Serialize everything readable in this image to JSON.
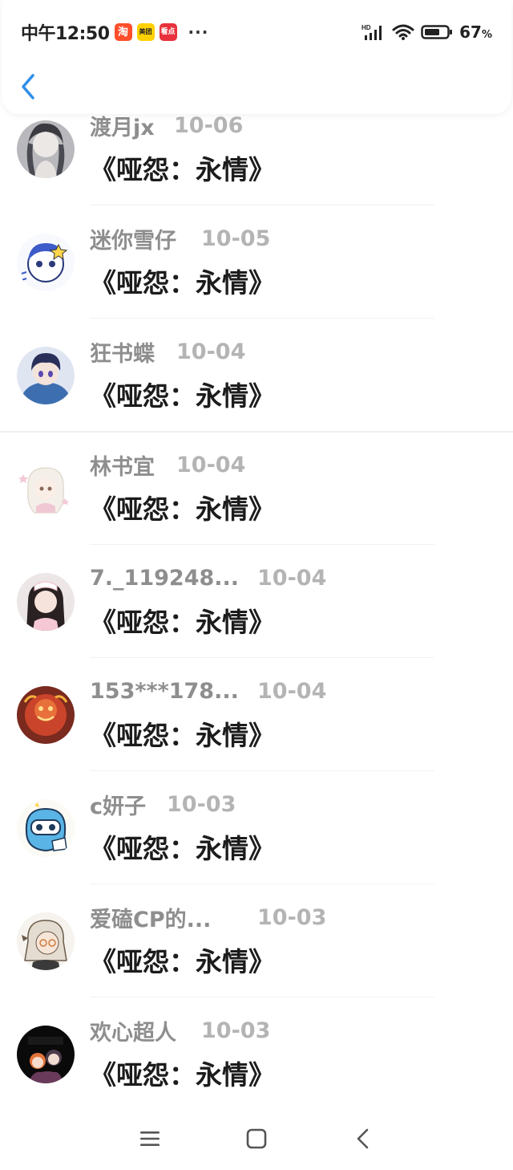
{
  "status_bar": {
    "time": "中午12:50",
    "apps": [
      {
        "name": "taobao-icon",
        "label": "淘"
      },
      {
        "name": "meituan-icon",
        "label": "美团"
      },
      {
        "name": "kandian-icon",
        "label": "看点"
      }
    ],
    "more": "···",
    "network": "HD",
    "battery": "67",
    "battery_unit": "%"
  },
  "colors": {
    "accent": "#2f8fe8",
    "name_gray": "#8e8e8e",
    "date_gray": "#b4b4b4",
    "title_black": "#1c1c1c"
  },
  "list": {
    "items": [
      {
        "name": "渡月jx",
        "date": "10-06",
        "title": "《哑怨：永情》",
        "avatar": "anime-girl-gray"
      },
      {
        "name": "迷你雪仔",
        "date": "10-05",
        "title": "《哑怨：永情》",
        "avatar": "chibi-blue-star"
      },
      {
        "name": "狂书蝶",
        "date": "10-04",
        "title": "《哑怨：永情》",
        "avatar": "anime-boy-blue"
      },
      {
        "name": "林书宜",
        "date": "10-04",
        "title": "《哑怨：永情》",
        "avatar": "anime-girl-white"
      },
      {
        "name": "7._119248...",
        "date": "10-04",
        "title": "《哑怨：永情》",
        "avatar": "photo-girl-pink"
      },
      {
        "name": "153***178...",
        "date": "10-04",
        "title": "《哑怨：永情》",
        "avatar": "lion-dance-red"
      },
      {
        "name": "c妍子",
        "date": "10-03",
        "title": "《哑怨：永情》",
        "avatar": "cartoon-blue-face"
      },
      {
        "name": "爱磕CP的...",
        "date": "10-03",
        "title": "《哑怨：永情》",
        "avatar": "anime-elder-glasses"
      },
      {
        "name": "欢心超人",
        "date": "10-03",
        "title": "《哑怨：永情》",
        "avatar": "chibi-couple-dark"
      }
    ]
  }
}
